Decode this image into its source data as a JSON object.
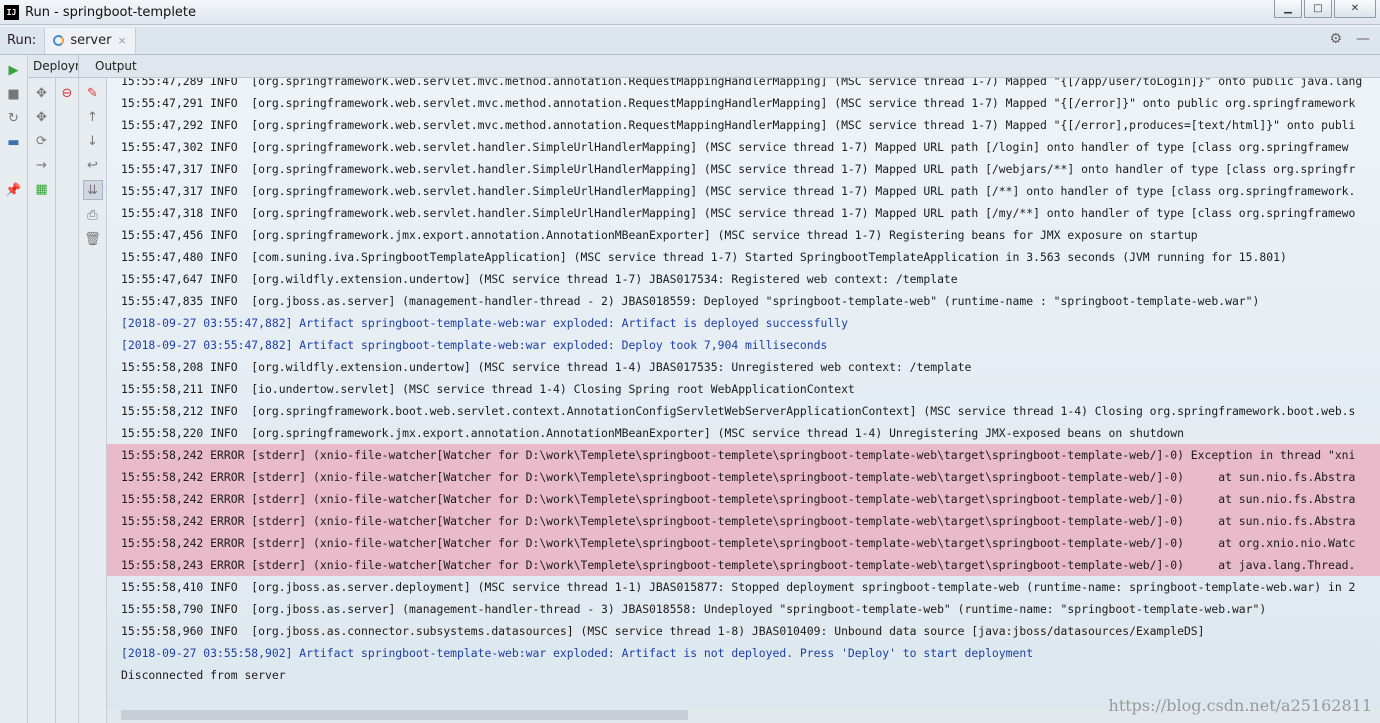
{
  "window": {
    "title": "Run - springboot-templete",
    "app_icon": "IJ"
  },
  "runbar": {
    "label": "Run:",
    "tab": "server",
    "tab_close": "×"
  },
  "subtabs": {
    "deploy": "Deployment",
    "output": "Output"
  },
  "console": {
    "partial_line": "15:55:47,289 INFO  [org.springframework.web.servlet.mvc.method.annotation.RequestMappingHandlerMapping] (MSC service thread 1-7) Mapped \"{[/app/user/toLogin]}\" onto public java.lang",
    "lines": [
      {
        "text": "15:55:47,291 INFO  [org.springframework.web.servlet.mvc.method.annotation.RequestMappingHandlerMapping] (MSC service thread 1-7) Mapped \"{[/error]}\" onto public org.springframework",
        "kind": "info"
      },
      {
        "text": "15:55:47,292 INFO  [org.springframework.web.servlet.mvc.method.annotation.RequestMappingHandlerMapping] (MSC service thread 1-7) Mapped \"{[/error],produces=[text/html]}\" onto publi",
        "kind": "info"
      },
      {
        "text": "15:55:47,302 INFO  [org.springframework.web.servlet.handler.SimpleUrlHandlerMapping] (MSC service thread 1-7) Mapped URL path [/login] onto handler of type [class org.springframew",
        "kind": "info"
      },
      {
        "text": "15:55:47,317 INFO  [org.springframework.web.servlet.handler.SimpleUrlHandlerMapping] (MSC service thread 1-7) Mapped URL path [/webjars/**] onto handler of type [class org.springfr",
        "kind": "info"
      },
      {
        "text": "15:55:47,317 INFO  [org.springframework.web.servlet.handler.SimpleUrlHandlerMapping] (MSC service thread 1-7) Mapped URL path [/**] onto handler of type [class org.springframework.",
        "kind": "info"
      },
      {
        "text": "15:55:47,318 INFO  [org.springframework.web.servlet.handler.SimpleUrlHandlerMapping] (MSC service thread 1-7) Mapped URL path [/my/**] onto handler of type [class org.springframewo",
        "kind": "info"
      },
      {
        "text": "15:55:47,456 INFO  [org.springframework.jmx.export.annotation.AnnotationMBeanExporter] (MSC service thread 1-7) Registering beans for JMX exposure on startup",
        "kind": "info"
      },
      {
        "text": "15:55:47,480 INFO  [com.suning.iva.SpringbootTemplateApplication] (MSC service thread 1-7) Started SpringbootTemplateApplication in 3.563 seconds (JVM running for 15.801)",
        "kind": "info"
      },
      {
        "text": "15:55:47,647 INFO  [org.wildfly.extension.undertow] (MSC service thread 1-7) JBAS017534: Registered web context: /template",
        "kind": "info"
      },
      {
        "text": "15:55:47,835 INFO  [org.jboss.as.server] (management-handler-thread - 2) JBAS018559: Deployed \"springboot-template-web\" (runtime-name : \"springboot-template-web.war\")",
        "kind": "info"
      },
      {
        "text": "[2018-09-27 03:55:47,882] Artifact springboot-template-web:war exploded: Artifact is deployed successfully",
        "kind": "blue"
      },
      {
        "text": "[2018-09-27 03:55:47,882] Artifact springboot-template-web:war exploded: Deploy took 7,904 milliseconds",
        "kind": "blue"
      },
      {
        "text": "15:55:58,208 INFO  [org.wildfly.extension.undertow] (MSC service thread 1-4) JBAS017535: Unregistered web context: /template",
        "kind": "info"
      },
      {
        "text": "15:55:58,211 INFO  [io.undertow.servlet] (MSC service thread 1-4) Closing Spring root WebApplicationContext",
        "kind": "info"
      },
      {
        "text": "15:55:58,212 INFO  [org.springframework.boot.web.servlet.context.AnnotationConfigServletWebServerApplicationContext] (MSC service thread 1-4) Closing org.springframework.boot.web.s",
        "kind": "info"
      },
      {
        "text": "15:55:58,220 INFO  [org.springframework.jmx.export.annotation.AnnotationMBeanExporter] (MSC service thread 1-4) Unregistering JMX-exposed beans on shutdown",
        "kind": "info"
      },
      {
        "text": "15:55:58,242 ERROR [stderr] (xnio-file-watcher[Watcher for D:\\work\\Templete\\springboot-templete\\springboot-template-web\\target\\springboot-template-web/]-0) Exception in thread \"xni",
        "kind": "error"
      },
      {
        "text": "15:55:58,242 ERROR [stderr] (xnio-file-watcher[Watcher for D:\\work\\Templete\\springboot-templete\\springboot-template-web\\target\\springboot-template-web/]-0)     at sun.nio.fs.Abstra",
        "kind": "error"
      },
      {
        "text": "15:55:58,242 ERROR [stderr] (xnio-file-watcher[Watcher for D:\\work\\Templete\\springboot-templete\\springboot-template-web\\target\\springboot-template-web/]-0)     at sun.nio.fs.Abstra",
        "kind": "error"
      },
      {
        "text": "15:55:58,242 ERROR [stderr] (xnio-file-watcher[Watcher for D:\\work\\Templete\\springboot-templete\\springboot-template-web\\target\\springboot-template-web/]-0)     at sun.nio.fs.Abstra",
        "kind": "error"
      },
      {
        "text": "15:55:58,242 ERROR [stderr] (xnio-file-watcher[Watcher for D:\\work\\Templete\\springboot-templete\\springboot-template-web\\target\\springboot-template-web/]-0)     at org.xnio.nio.Watc",
        "kind": "error"
      },
      {
        "text": "15:55:58,243 ERROR [stderr] (xnio-file-watcher[Watcher for D:\\work\\Templete\\springboot-templete\\springboot-template-web\\target\\springboot-template-web/]-0)     at java.lang.Thread.",
        "kind": "error"
      },
      {
        "text": "15:55:58,410 INFO  [org.jboss.as.server.deployment] (MSC service thread 1-1) JBAS015877: Stopped deployment springboot-template-web (runtime-name: springboot-template-web.war) in 2",
        "kind": "info"
      },
      {
        "text": "15:55:58,790 INFO  [org.jboss.as.server] (management-handler-thread - 3) JBAS018558: Undeployed \"springboot-template-web\" (runtime-name: \"springboot-template-web.war\")",
        "kind": "info"
      },
      {
        "text": "15:55:58,960 INFO  [org.jboss.as.connector.subsystems.datasources] (MSC service thread 1-8) JBAS010409: Unbound data source [java:jboss/datasources/ExampleDS]",
        "kind": "info"
      },
      {
        "text": "[2018-09-27 03:55:58,902] Artifact springboot-template-web:war exploded: Artifact is not deployed. Press 'Deploy' to start deployment",
        "kind": "blue"
      },
      {
        "text": "Disconnected from server",
        "kind": "info"
      }
    ]
  },
  "watermark": "https://blog.csdn.net/a25162811",
  "colors": {
    "info": "#1c1c1c",
    "blue": "#1d3fa8",
    "error_bg": "#eca0b4",
    "run_green": "#3aa23a"
  }
}
